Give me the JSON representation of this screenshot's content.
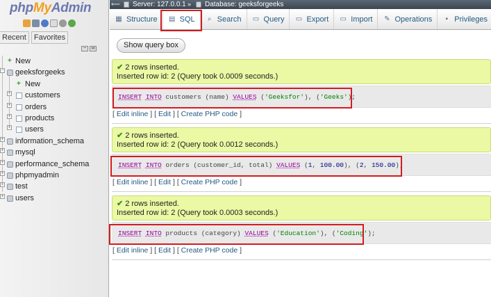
{
  "nav": {
    "logo": {
      "php": "php",
      "my": "My",
      "admin": "Admin"
    },
    "tabs": {
      "recent": "Recent",
      "favorites": "Favorites"
    },
    "tree": [
      {
        "label": "New",
        "type": "new",
        "level": 0
      },
      {
        "label": "geeksforgeeks",
        "type": "db",
        "level": 0,
        "expanded": true
      },
      {
        "label": "New",
        "type": "new",
        "level": 1
      },
      {
        "label": "customers",
        "type": "table",
        "level": 1
      },
      {
        "label": "orders",
        "type": "table",
        "level": 1
      },
      {
        "label": "products",
        "type": "table",
        "level": 1
      },
      {
        "label": "users",
        "type": "table",
        "level": 1
      },
      {
        "label": "information_schema",
        "type": "db",
        "level": 0
      },
      {
        "label": "mysql",
        "type": "db",
        "level": 0
      },
      {
        "label": "performance_schema",
        "type": "db",
        "level": 0
      },
      {
        "label": "phpmyadmin",
        "type": "db",
        "level": 0
      },
      {
        "label": "test",
        "type": "db",
        "level": 0
      },
      {
        "label": "users",
        "type": "db",
        "level": 0
      }
    ]
  },
  "breadcrumb": {
    "server": "Server: 127.0.0.1",
    "database": "Database: geeksforgeeks"
  },
  "tabs": [
    {
      "label": "Structure",
      "icon": "structure-icon",
      "active": false
    },
    {
      "label": "SQL",
      "icon": "sql-icon",
      "active": true
    },
    {
      "label": "Search",
      "icon": "search-icon",
      "active": false
    },
    {
      "label": "Query",
      "icon": "query-icon",
      "active": false
    },
    {
      "label": "Export",
      "icon": "export-icon",
      "active": false
    },
    {
      "label": "Import",
      "icon": "import-icon",
      "active": false
    },
    {
      "label": "Operations",
      "icon": "wrench-icon",
      "active": false
    },
    {
      "label": "Privileges",
      "icon": "privileges-icon",
      "active": false
    }
  ],
  "show_query_box": "Show query box",
  "results": [
    {
      "status": "2 rows inserted.",
      "detail": "Inserted row id: 2 (Query took 0.0009 seconds.)",
      "sql_parts": [
        {
          "t": "kw",
          "v": "INSERT"
        },
        {
          "t": "p",
          "v": " "
        },
        {
          "t": "kw",
          "v": "INTO"
        },
        {
          "t": "p",
          "v": " customers (name) "
        },
        {
          "t": "kw",
          "v": "VALUES"
        },
        {
          "t": "p",
          "v": " ("
        },
        {
          "t": "str",
          "v": "'Geeksfor'"
        },
        {
          "t": "p",
          "v": "), ("
        },
        {
          "t": "str",
          "v": "'Geeks'"
        },
        {
          "t": "p",
          "v": ");"
        }
      ]
    },
    {
      "status": "2 rows inserted.",
      "detail": "Inserted row id: 2 (Query took 0.0012 seconds.)",
      "sql_parts": [
        {
          "t": "kw",
          "v": "INSERT"
        },
        {
          "t": "p",
          "v": " "
        },
        {
          "t": "kw",
          "v": "INTO"
        },
        {
          "t": "p",
          "v": " orders (customer_id, total) "
        },
        {
          "t": "kw",
          "v": "VALUES"
        },
        {
          "t": "p",
          "v": " ("
        },
        {
          "t": "num",
          "v": "1"
        },
        {
          "t": "p",
          "v": ", "
        },
        {
          "t": "num",
          "v": "100.00"
        },
        {
          "t": "p",
          "v": "), ("
        },
        {
          "t": "num",
          "v": "2"
        },
        {
          "t": "p",
          "v": ", "
        },
        {
          "t": "num",
          "v": "150.00"
        },
        {
          "t": "p",
          "v": ");"
        }
      ]
    },
    {
      "status": "2 rows inserted.",
      "detail": "Inserted row id: 2 (Query took 0.0003 seconds.)",
      "sql_parts": [
        {
          "t": "kw",
          "v": "INSERT"
        },
        {
          "t": "p",
          "v": " "
        },
        {
          "t": "kw",
          "v": "INTO"
        },
        {
          "t": "p",
          "v": " products (category) "
        },
        {
          "t": "kw",
          "v": "VALUES"
        },
        {
          "t": "p",
          "v": " ("
        },
        {
          "t": "str",
          "v": "'Education'"
        },
        {
          "t": "p",
          "v": "), ("
        },
        {
          "t": "str",
          "v": "'Coding'"
        },
        {
          "t": "p",
          "v": ");"
        }
      ]
    }
  ],
  "links": {
    "edit_inline": "Edit inline",
    "edit": "Edit",
    "create_php": "Create PHP code"
  },
  "colors": {
    "highlight": "#d21c20",
    "success_bg": "#ebf8a4",
    "link": "#235a81"
  }
}
